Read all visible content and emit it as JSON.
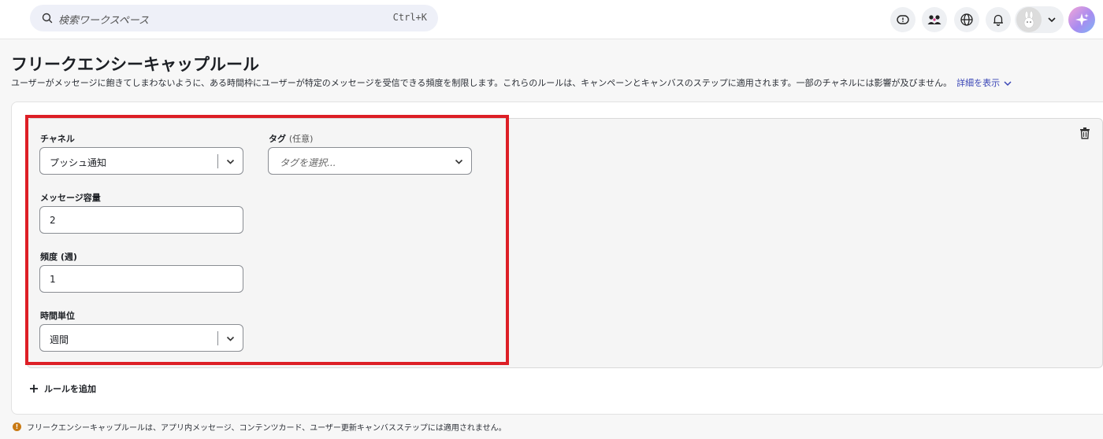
{
  "search": {
    "placeholder": "検索ワークスペース",
    "shortcut": "Ctrl+K"
  },
  "header_icons": [
    "feedback-icon",
    "users-icon",
    "globe-icon",
    "bell-icon",
    "avatar",
    "chevron-down-icon",
    "sparkle-icon"
  ],
  "page": {
    "title": "フリークエンシーキャップルール",
    "description": "ユーザーがメッセージに飽きてしまわないように、ある時間枠にユーザーが特定のメッセージを受信できる頻度を制限します。これらのルールは、キャンペーンとキャンバスのステップに適用されます。一部のチャネルには影響が及びません。",
    "show_details": "詳細を表示"
  },
  "rule": {
    "channel_label": "チャネル",
    "channel_value": "プッシュ通知",
    "tag_label": "タグ",
    "tag_optional": "(任意)",
    "tag_placeholder": "タグを選択...",
    "capacity_label": "メッセージ容量",
    "capacity_value": "2",
    "frequency_label": "頻度 (週)",
    "frequency_value": "1",
    "time_unit_label": "時間単位",
    "time_unit_value": "週間"
  },
  "add_rule_label": "ルールを追加",
  "footnote": "フリークエンシーキャップルールは、アプリ内メッセージ、コンテンツカード、ユーザー更新キャンバスステップには適用されません。",
  "colors": {
    "highlight": "#dd1f26",
    "link": "#3a46b6",
    "warning": "#c97a14"
  }
}
